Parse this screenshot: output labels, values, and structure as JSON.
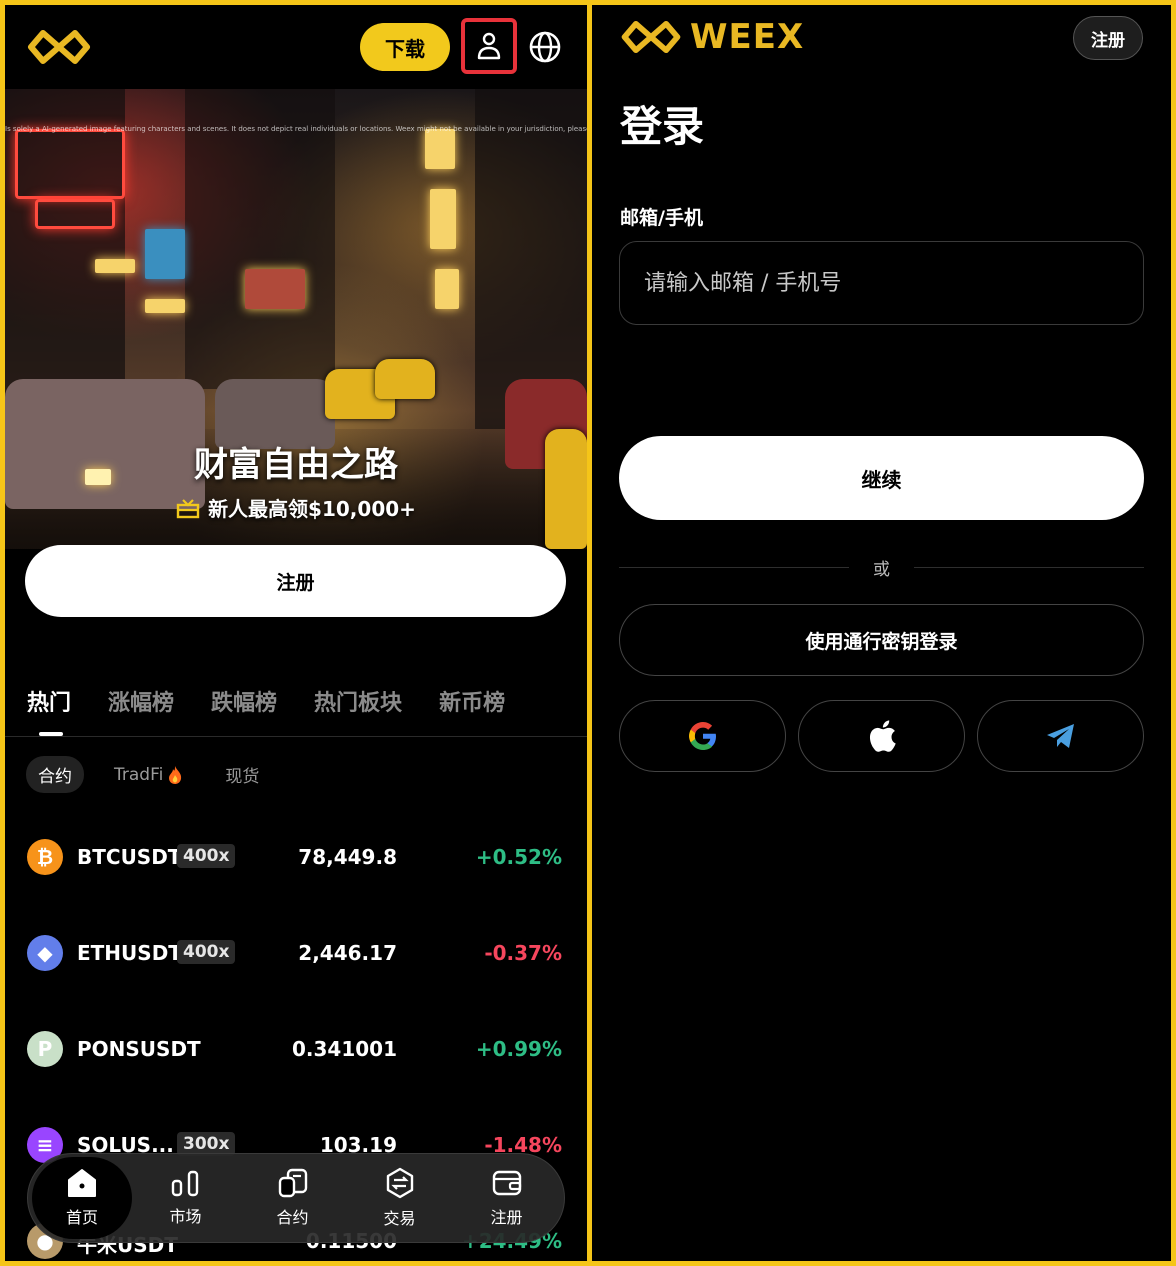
{
  "left": {
    "header": {
      "download_label": "下载",
      "icons": [
        "weex-logo-icon",
        "user-icon",
        "globe-icon"
      ]
    },
    "hero": {
      "fine_print": "Is solely a AI-generated image featuring characters and scenes. It does not depict real individuals or locations. Weex might not be available in your jurisdiction, please refer to the Terms of Use.",
      "title": "财富自由之路",
      "subtitle": "新人最高领$10,000+"
    },
    "register_label": "注册",
    "tabs": [
      "热门",
      "涨幅榜",
      "跌幅榜",
      "热门板块",
      "新币榜"
    ],
    "subtabs": [
      "合约",
      "TradFi",
      "现货"
    ],
    "markets": [
      {
        "symbol": "BTCUSDT",
        "leverage": "400x",
        "price": "78,449.8",
        "change": "+0.52%",
        "direction": "up",
        "icon_color": "#f7931a",
        "icon_glyph": "₿"
      },
      {
        "symbol": "ETHUSDT",
        "leverage": "400x",
        "price": "2,446.17",
        "change": "-0.37%",
        "direction": "down",
        "icon_color": "#627eea",
        "icon_glyph": "◆"
      },
      {
        "symbol": "PONSUSDT",
        "leverage": "",
        "price": "0.341001",
        "change": "+0.99%",
        "direction": "up",
        "icon_color": "#c9e0c8",
        "icon_glyph": "P"
      },
      {
        "symbol": "SOLUS...",
        "leverage": "300x",
        "price": "103.19",
        "change": "-1.48%",
        "direction": "down",
        "icon_color": "#9945ff",
        "icon_glyph": "≡"
      },
      {
        "symbol": "牛米USDT",
        "leverage": "",
        "price": "0.11500",
        "change": "+24.49%",
        "direction": "up",
        "icon_color": "#b89a6a",
        "icon_glyph": "●"
      }
    ],
    "bottom_nav": [
      {
        "label": "首页",
        "icon": "home-icon"
      },
      {
        "label": "市场",
        "icon": "chart-bars-icon"
      },
      {
        "label": "合约",
        "icon": "contract-icon"
      },
      {
        "label": "交易",
        "icon": "exchange-icon"
      },
      {
        "label": "注册",
        "icon": "wallet-icon"
      }
    ],
    "colors": {
      "accent": "#f2c91c",
      "up": "#2ebd85",
      "down": "#f6465d",
      "highlight_border": "#e8323a"
    }
  },
  "right": {
    "brand": "WEEX",
    "register_label": "注册",
    "title": "登录",
    "field_label": "邮箱/手机",
    "field_placeholder": "请输入邮箱 / 手机号",
    "continue_label": "继续",
    "or_label": "或",
    "passkey_label": "使用通行密钥登录",
    "social_icons": [
      "google-icon",
      "apple-icon",
      "telegram-icon"
    ]
  }
}
